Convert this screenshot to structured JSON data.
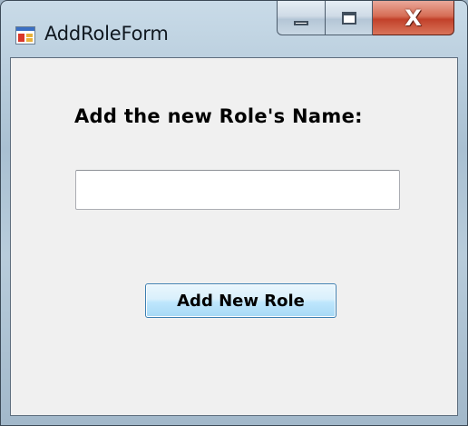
{
  "window": {
    "title": "AddRoleForm",
    "icon": "form-app-icon",
    "controls": {
      "minimize_icon": "minimize-icon",
      "maximize_icon": "maximize-icon",
      "close_icon": "close-icon",
      "close_glyph": "X"
    }
  },
  "form": {
    "prompt_label": "Add the new Role's Name:",
    "role_name_value": "",
    "submit_label": "Add New Role"
  },
  "colors": {
    "client_background": "#f0f0f0",
    "button_border": "#3c7fb1",
    "close_button": "#c2412a"
  }
}
